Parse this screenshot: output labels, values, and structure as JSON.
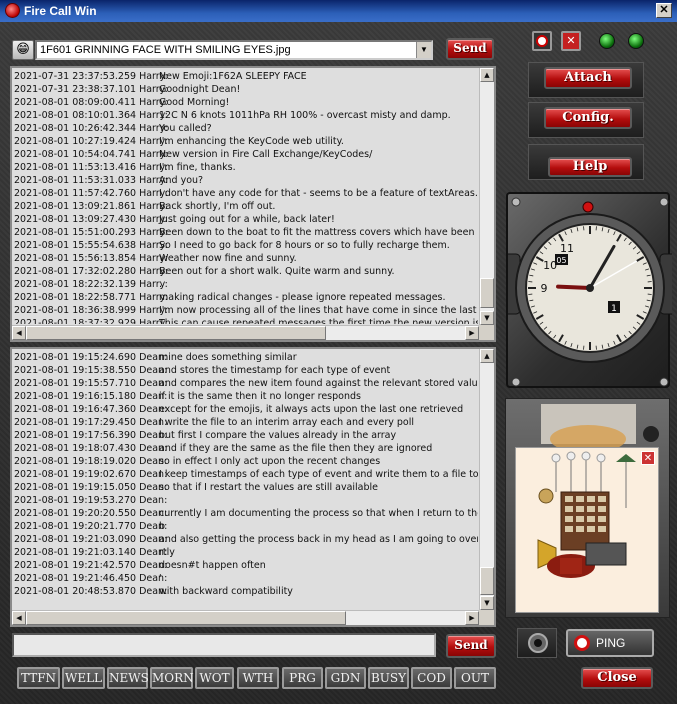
{
  "window": {
    "title": "Fire Call Win",
    "close_glyph": "✕"
  },
  "emoji": {
    "icon": "😁",
    "selected": "1F601 GRINNING FACE WITH SMILING EYES.jpg",
    "send_label": "Send"
  },
  "top_log": {
    "rows": [
      {
        "ts": "2021-07-31 23:37:53.259 Harry:",
        "msg": "New Emoji:1F62A SLEEPY FACE"
      },
      {
        "ts": "2021-07-31 23:38:37.101 Harry:",
        "msg": "Goodnight Dean!"
      },
      {
        "ts": "2021-08-01 08:09:00.411 Harry:",
        "msg": "Good Morning!"
      },
      {
        "ts": "2021-08-01 08:10:01.364 Harry:",
        "msg": "12C N 6 knots 1011hPa RH 100% - overcast misty and damp."
      },
      {
        "ts": "2021-08-01 10:26:42.344 Harry:",
        "msg": "You called?"
      },
      {
        "ts": "2021-08-01 10:27:19.424 Harry:",
        "msg": "I'm enhancing the KeyCode web utility."
      },
      {
        "ts": "2021-08-01 10:54:04.741 Harry:",
        "msg": "New version in Fire Call Exchange/KeyCodes/"
      },
      {
        "ts": "2021-08-01 11:53:13.416 Harry:",
        "msg": "I'm fine, thanks."
      },
      {
        "ts": "2021-08-01 11:53:31.033 Harry:",
        "msg": "And you?"
      },
      {
        "ts": "2021-08-01 11:57:42.760 Harry:",
        "msg": "I don't have any code for that - seems to be a feature of textAreas."
      },
      {
        "ts": "2021-08-01 13:09:21.861 Harry:",
        "msg": "Back shortly,  I'm off out."
      },
      {
        "ts": "2021-08-01 13:09:27.430 Harry:",
        "msg": "Just going out for a while,  back later!"
      },
      {
        "ts": "2021-08-01 15:51:00.293 Harry:",
        "msg": "Been down to the boat to fit the mattress covers which have been dr"
      },
      {
        "ts": "2021-08-01 15:55:54.638 Harry:",
        "msg": "So I need to go back for 8 hours or so to fully recharge them."
      },
      {
        "ts": "2021-08-01 15:56:13.854 Harry:",
        "msg": "Weather now fine and sunny."
      },
      {
        "ts": "2021-08-01 17:32:02.280 Harry:",
        "msg": "Been out for a short walk. Quite warm and sunny."
      },
      {
        "ts": "2021-08-01 18:22:32.139 Harry:",
        "msg": "."
      },
      {
        "ts": "2021-08-01 18:22:58.771 Harry:",
        "msg": "making radical changes - please ignore repeated messages."
      },
      {
        "ts": "2021-08-01 18:36:38.999 Harry:",
        "msg": "I'm now processing all of the lines that have come in since the last ch"
      },
      {
        "ts": "2021-08-01 18:37:32.929 Harry:",
        "msg": "This can cause repeated messages the first time the new version is sta"
      }
    ]
  },
  "bottom_log": {
    "rows": [
      {
        "ts": "2021-08-01 19:15:24.690 Dean:",
        "msg": "mine does something similar"
      },
      {
        "ts": "2021-08-01 19:15:38.550 Dean:",
        "msg": "and stores the timestamp for each type of event"
      },
      {
        "ts": "2021-08-01 19:15:57.710 Dean:",
        "msg": "and compares the new item found against the relevant stored value"
      },
      {
        "ts": "2021-08-01 19:16:15.180 Dean:",
        "msg": "if it is the same then it no longer responds"
      },
      {
        "ts": "2021-08-01 19:16:47.360 Dean:",
        "msg": "except for the emojis, it always acts upon the last one retrieved"
      },
      {
        "ts": "2021-08-01 19:17:29.450 Dean:",
        "msg": "I write the file to an interim array each and every poll"
      },
      {
        "ts": "2021-08-01 19:17:56.390 Dean:",
        "msg": "but first I compare the values already in the array"
      },
      {
        "ts": "2021-08-01 19:18:07.430 Dean:",
        "msg": "and if they are the same as the file then they are ignored"
      },
      {
        "ts": "2021-08-01 19:18:19.020 Dean:",
        "msg": "so in effect I only act upon the recent changes"
      },
      {
        "ts": "2021-08-01 19:19:02.670 Dean:",
        "msg": "I keep timestamps of each type of event and write them to a file too"
      },
      {
        "ts": "2021-08-01 19:19:15.050 Dean:",
        "msg": "so that if I restart the values are still available"
      },
      {
        "ts": "2021-08-01 19:19:53.270 Dean:",
        "msg": ""
      },
      {
        "ts": "2021-08-01 19:20:20.550 Dean:",
        "msg": "currently I am documenting the process so that when I return to the"
      },
      {
        "ts": "2021-08-01 19:20:21.770 Dean:",
        "msg": "b"
      },
      {
        "ts": "2021-08-01 19:21:03.090 Dean:",
        "msg": "and also getting the process back in my head as I am going to overhau"
      },
      {
        "ts": "2021-08-01 19:21:03.140 Dean:",
        "msg": "rtly"
      },
      {
        "ts": "2021-08-01 19:21:42.570 Dean:",
        "msg": "doesn#t happen often"
      },
      {
        "ts": "2021-08-01 19:21:46.450 Dean:",
        "msg": "'"
      },
      {
        "ts": "2021-08-01 20:48:53.870 Dean:",
        "msg": "with backward compatibility"
      }
    ]
  },
  "compose": {
    "value": "",
    "send_label": "Send"
  },
  "quick_buttons": [
    "TTFN",
    "WELL",
    "NEWS",
    "MORN",
    "WOT",
    "WTH",
    "PRG",
    "GDN",
    "BUSY",
    "COD",
    "OUT"
  ],
  "side": {
    "attach_label": "Attach",
    "config_label": "Config.",
    "help_label": "Help",
    "ping_label": "PING",
    "close_label": "Close"
  },
  "clock": {
    "minute_label": "05",
    "day": "1",
    "hours": 9,
    "minutes": 5,
    "seconds": 10
  },
  "icons": {
    "emoji_picker": "grinning-face-icon",
    "record": "record-icon",
    "stop": "stop-x-icon",
    "status_leds": "green-led-icon"
  },
  "colors": {
    "accent_red": "#b40d0d",
    "led_green": "#1aa31a",
    "log_bg": "#dedede"
  }
}
